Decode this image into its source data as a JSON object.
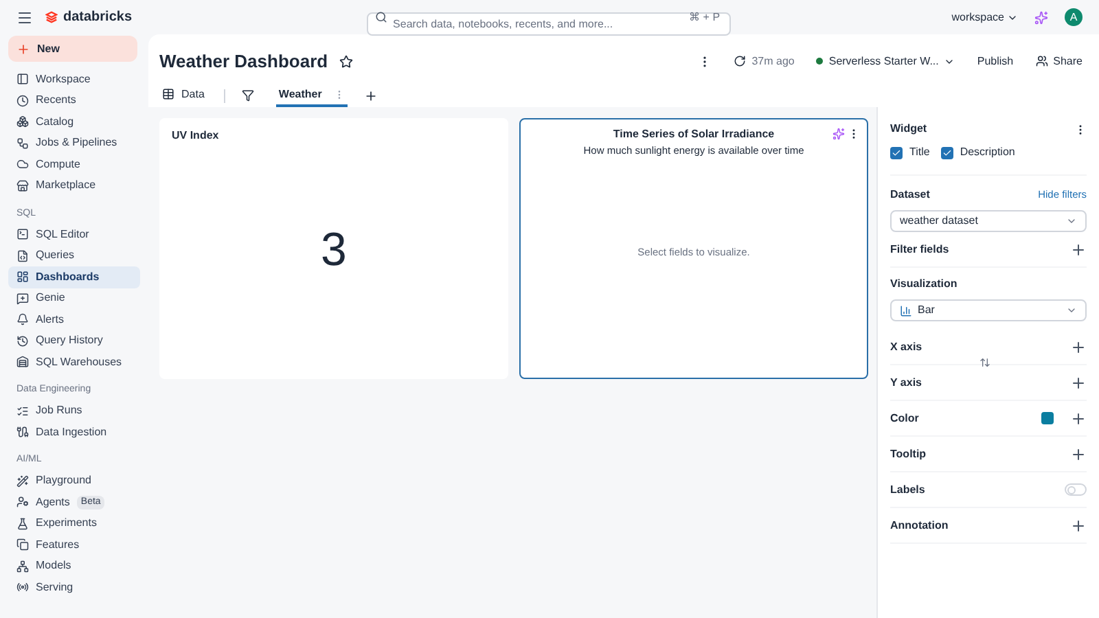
{
  "topbar": {
    "brand": "databricks",
    "search": {
      "placeholder": "Search data, notebooks, recents, and more...",
      "shortcut": "⌘ + P"
    },
    "workspace": "workspace",
    "avatar": "A"
  },
  "sidebar": {
    "new_button": "New",
    "sections": [
      {
        "items": [
          {
            "label": "Workspace",
            "selected": false
          },
          {
            "label": "Recents",
            "selected": false
          },
          {
            "label": "Catalog",
            "selected": false
          },
          {
            "label": "Jobs & Pipelines",
            "selected": false
          },
          {
            "label": "Compute",
            "selected": false
          },
          {
            "label": "Marketplace",
            "selected": false
          }
        ]
      },
      {
        "label": "SQL",
        "items": [
          {
            "label": "SQL Editor",
            "selected": false
          },
          {
            "label": "Queries",
            "selected": false
          },
          {
            "label": "Dashboards",
            "selected": true
          },
          {
            "label": "Genie",
            "selected": false
          },
          {
            "label": "Alerts",
            "selected": false
          },
          {
            "label": "Query History",
            "selected": false
          },
          {
            "label": "SQL Warehouses",
            "selected": false
          }
        ]
      },
      {
        "label": "Data Engineering",
        "items": [
          {
            "label": "Job Runs",
            "selected": false
          },
          {
            "label": "Data Ingestion",
            "selected": false
          }
        ]
      },
      {
        "label": "AI/ML",
        "items": [
          {
            "label": "Playground",
            "selected": false
          },
          {
            "label": "Agents",
            "selected": false,
            "badge": "Beta"
          },
          {
            "label": "Experiments",
            "selected": false
          },
          {
            "label": "Features",
            "selected": false
          },
          {
            "label": "Models",
            "selected": false
          },
          {
            "label": "Serving",
            "selected": false
          }
        ]
      }
    ]
  },
  "header": {
    "title": "Weather Dashboard",
    "refreshed": "37m ago",
    "warehouse": "Serverless Starter W...",
    "publish": "Publish",
    "share": "Share"
  },
  "tabs": [
    {
      "label": "Data",
      "kind": "data",
      "selected": false
    },
    {
      "label": "Weather",
      "kind": "page",
      "selected": true
    }
  ],
  "widgets": [
    {
      "kind": "counter",
      "title": "UV Index",
      "value": "3",
      "selected": false
    },
    {
      "kind": "chart",
      "title": "Time Series of Solar Irradiance",
      "description": "How much sunlight energy is available over time",
      "empty_text": "Select fields to visualize.",
      "selected": true
    }
  ],
  "config": {
    "widget_label": "Widget",
    "options": [
      {
        "label": "Title",
        "checked": true
      },
      {
        "label": "Description",
        "checked": true
      }
    ],
    "dataset_label": "Dataset",
    "hide_filters": "Hide filters",
    "dataset": "weather dataset",
    "filter_fields": "Filter fields",
    "visualization_label": "Visualization",
    "visualization": "Bar",
    "rows": [
      {
        "kind": "add",
        "label": "X axis"
      },
      {
        "kind": "add",
        "label": "Y axis"
      },
      {
        "kind": "color",
        "label": "Color",
        "color": "#0b7ea0"
      },
      {
        "kind": "add",
        "label": "Tooltip"
      },
      {
        "kind": "toggle",
        "label": "Labels",
        "on": false
      },
      {
        "kind": "add",
        "label": "Annotation"
      }
    ]
  }
}
